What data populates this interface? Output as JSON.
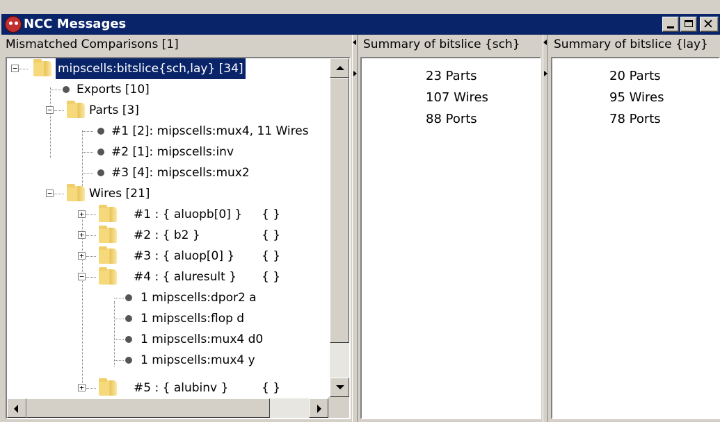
{
  "window": {
    "title": "NCC Messages"
  },
  "left_pane": {
    "header": "Mismatched Comparisons [1]",
    "tree": {
      "root": "mipscells:bitslice{sch,lay} [34]",
      "exports": "Exports [10]",
      "parts": {
        "label": "Parts [3]",
        "items": [
          "#1 [2]: mipscells:mux4, 11 Wires",
          "#2 [1]: mipscells:inv",
          "#3 [4]: mipscells:mux2"
        ]
      },
      "wires": {
        "label": "Wires [21]",
        "items": [
          {
            "num": "#1 : { aluopb[0] }",
            "other": "{ }"
          },
          {
            "num": "#2 : { b2 }",
            "other": "{ }"
          },
          {
            "num": "#3 : { aluop[0] }",
            "other": "{ }"
          },
          {
            "num": "#4 : { aluresult }",
            "other": "{ }"
          },
          {
            "num": "#5 : { alubinv }",
            "other": "{ }"
          }
        ],
        "wire4_children": [
          "1 mipscells:dpor2 a",
          "1 mipscells:flop d",
          "1 mipscells:mux4 d0",
          "1 mipscells:mux4 y"
        ]
      }
    }
  },
  "middle_pane": {
    "header": "Summary of bitslice {sch}",
    "lines": [
      "23 Parts",
      "107 Wires",
      "88 Ports"
    ]
  },
  "right_pane": {
    "header": "Summary of bitslice {lay}",
    "lines": [
      "20 Parts",
      "95 Wires",
      "78 Ports"
    ]
  },
  "colors": {
    "titlebar": "#0a246a",
    "chrome": "#d4d0c8",
    "selection": "#0a246a"
  }
}
